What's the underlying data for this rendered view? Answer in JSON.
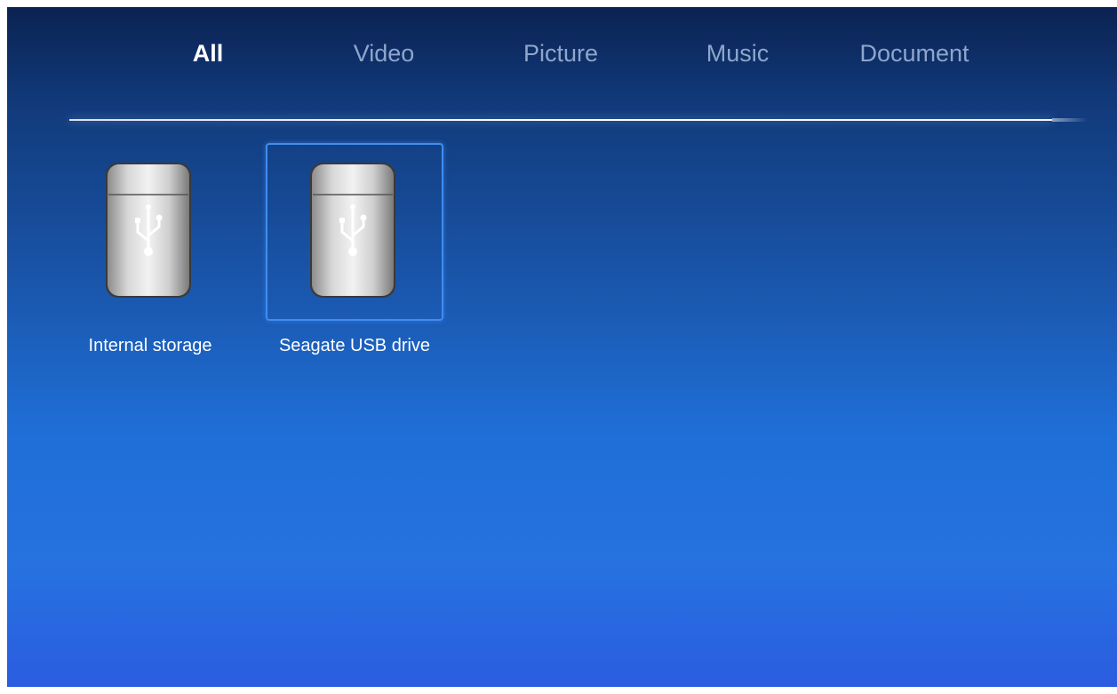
{
  "tabs": [
    {
      "label": "All",
      "active": true
    },
    {
      "label": "Video",
      "active": false
    },
    {
      "label": "Picture",
      "active": false
    },
    {
      "label": "Music",
      "active": false
    },
    {
      "label": "Document",
      "active": false
    }
  ],
  "devices": [
    {
      "label": "Internal storage",
      "icon": "usb-drive-icon",
      "selected": false
    },
    {
      "label": "Seagate USB drive",
      "icon": "usb-drive-icon",
      "selected": true
    }
  ],
  "colors": {
    "background_top": "#0b2252",
    "background_bottom": "#2b5ce0",
    "tab_inactive": "#8ea6cc",
    "tab_active": "#ffffff",
    "selection_border": "#3f8df0"
  }
}
